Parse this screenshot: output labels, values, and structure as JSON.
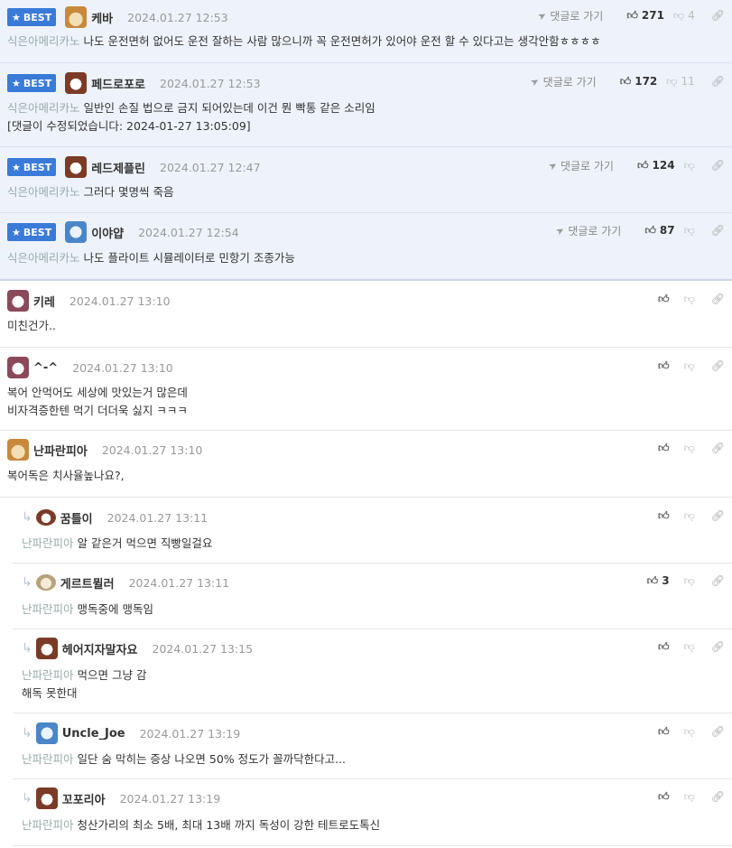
{
  "comments": [
    {
      "best": true,
      "avatar": "shiba",
      "nick": "케바",
      "date": "2024.01.27 12:53",
      "goto": "댓글로 가기",
      "up": "271",
      "down": "4",
      "ref": "식은아메리카노",
      "lines": [
        "나도 운전면허 없어도 운전 잘하는 사람 많으니까 꼭 운전면허가 있어야 운전 할 수 있다고는 생각안함ㅎㅎㅎㅎ"
      ]
    },
    {
      "best": true,
      "avatar": "dog",
      "nick": "페드로포로",
      "date": "2024.01.27 12:53",
      "goto": "댓글로 가기",
      "up": "172",
      "down": "11",
      "ref": "식은아메리카노",
      "lines": [
        "일반인 손질 법으로 금지 되어있는데 이건 뭔 빡통 같은 소리임",
        "[댓글이 수정되었습니다: 2024-01-27 13:05:09]"
      ]
    },
    {
      "best": true,
      "avatar": "dog",
      "nick": "레드제플린",
      "date": "2024.01.27 12:47",
      "goto": "댓글로 가기",
      "up": "124",
      "down": "",
      "ref": "식은아메리카노",
      "lines": [
        "그러다 몇명씩 죽음"
      ]
    },
    {
      "best": true,
      "avatar": "blue",
      "nick": "이야얍",
      "date": "2024.01.27 12:54",
      "goto": "댓글로 가기",
      "up": "87",
      "down": "",
      "ref": "식은아메리카노",
      "lines": [
        "나도 플라이트 시뮬레이터로 민항기 조종가능"
      ]
    },
    {
      "best": false,
      "avatar": "pink",
      "nick": "키레",
      "date": "2024.01.27 13:10",
      "up": "",
      "down": "",
      "ref": "",
      "lines": [
        "미친건가.."
      ]
    },
    {
      "best": false,
      "avatar": "pink",
      "nick": "^-^",
      "date": "2024.01.27 13:10",
      "up": "",
      "down": "",
      "ref": "",
      "lines": [
        "복어 안먹어도 세상에 맛있는거 많은데",
        "비자격증한텐 먹기 더더욱 싫지 ㅋㅋㅋ"
      ]
    },
    {
      "best": false,
      "avatar": "shiba",
      "nick": "난파란피아",
      "date": "2024.01.27 13:10",
      "up": "",
      "down": "",
      "ref": "",
      "lines": [
        "복어독은 치사율높나요?,"
      ]
    },
    {
      "best": false,
      "reply": true,
      "avatar": "dogsmall",
      "nick": "꿈틀이",
      "date": "2024.01.27 13:11",
      "up": "",
      "down": "",
      "ref": "난파란피아",
      "lines": [
        "알 같은거 먹으면 직빵일걸요"
      ]
    },
    {
      "best": false,
      "reply": true,
      "avatar": "tan",
      "nick": "게르트뮐러",
      "date": "2024.01.27 13:11",
      "up": "3",
      "down": "",
      "ref": "난파란피아",
      "lines": [
        "맹독중에 맹독임"
      ]
    },
    {
      "best": false,
      "reply": true,
      "avatar": "dog",
      "nick": "헤어지자말자요",
      "date": "2024.01.27 13:15",
      "up": "",
      "down": "",
      "ref": "난파란피아",
      "lines": [
        "먹으면 그냥 감",
        "해독 못한대"
      ]
    },
    {
      "best": false,
      "reply": true,
      "avatar": "blue",
      "nick": "Uncle_Joe",
      "date": "2024.01.27 13:19",
      "up": "",
      "down": "",
      "ref": "난파란피아",
      "lines": [
        "일단 숨 막히는 증상 나오면 50% 정도가 꼴까닥한다고..."
      ]
    },
    {
      "best": false,
      "reply": true,
      "avatar": "dog",
      "nick": "꼬포리아",
      "date": "2024.01.27 13:19",
      "up": "",
      "down": "",
      "ref": "난파란피아",
      "lines": [
        "청산가리의 최소 5배, 최대 13배 까지 독성이 강한 테트로도톡신"
      ]
    }
  ],
  "labels": {
    "best": "BEST"
  },
  "colors": {
    "best_bg": "#eef3fb",
    "badge": "#3a7ad8"
  }
}
